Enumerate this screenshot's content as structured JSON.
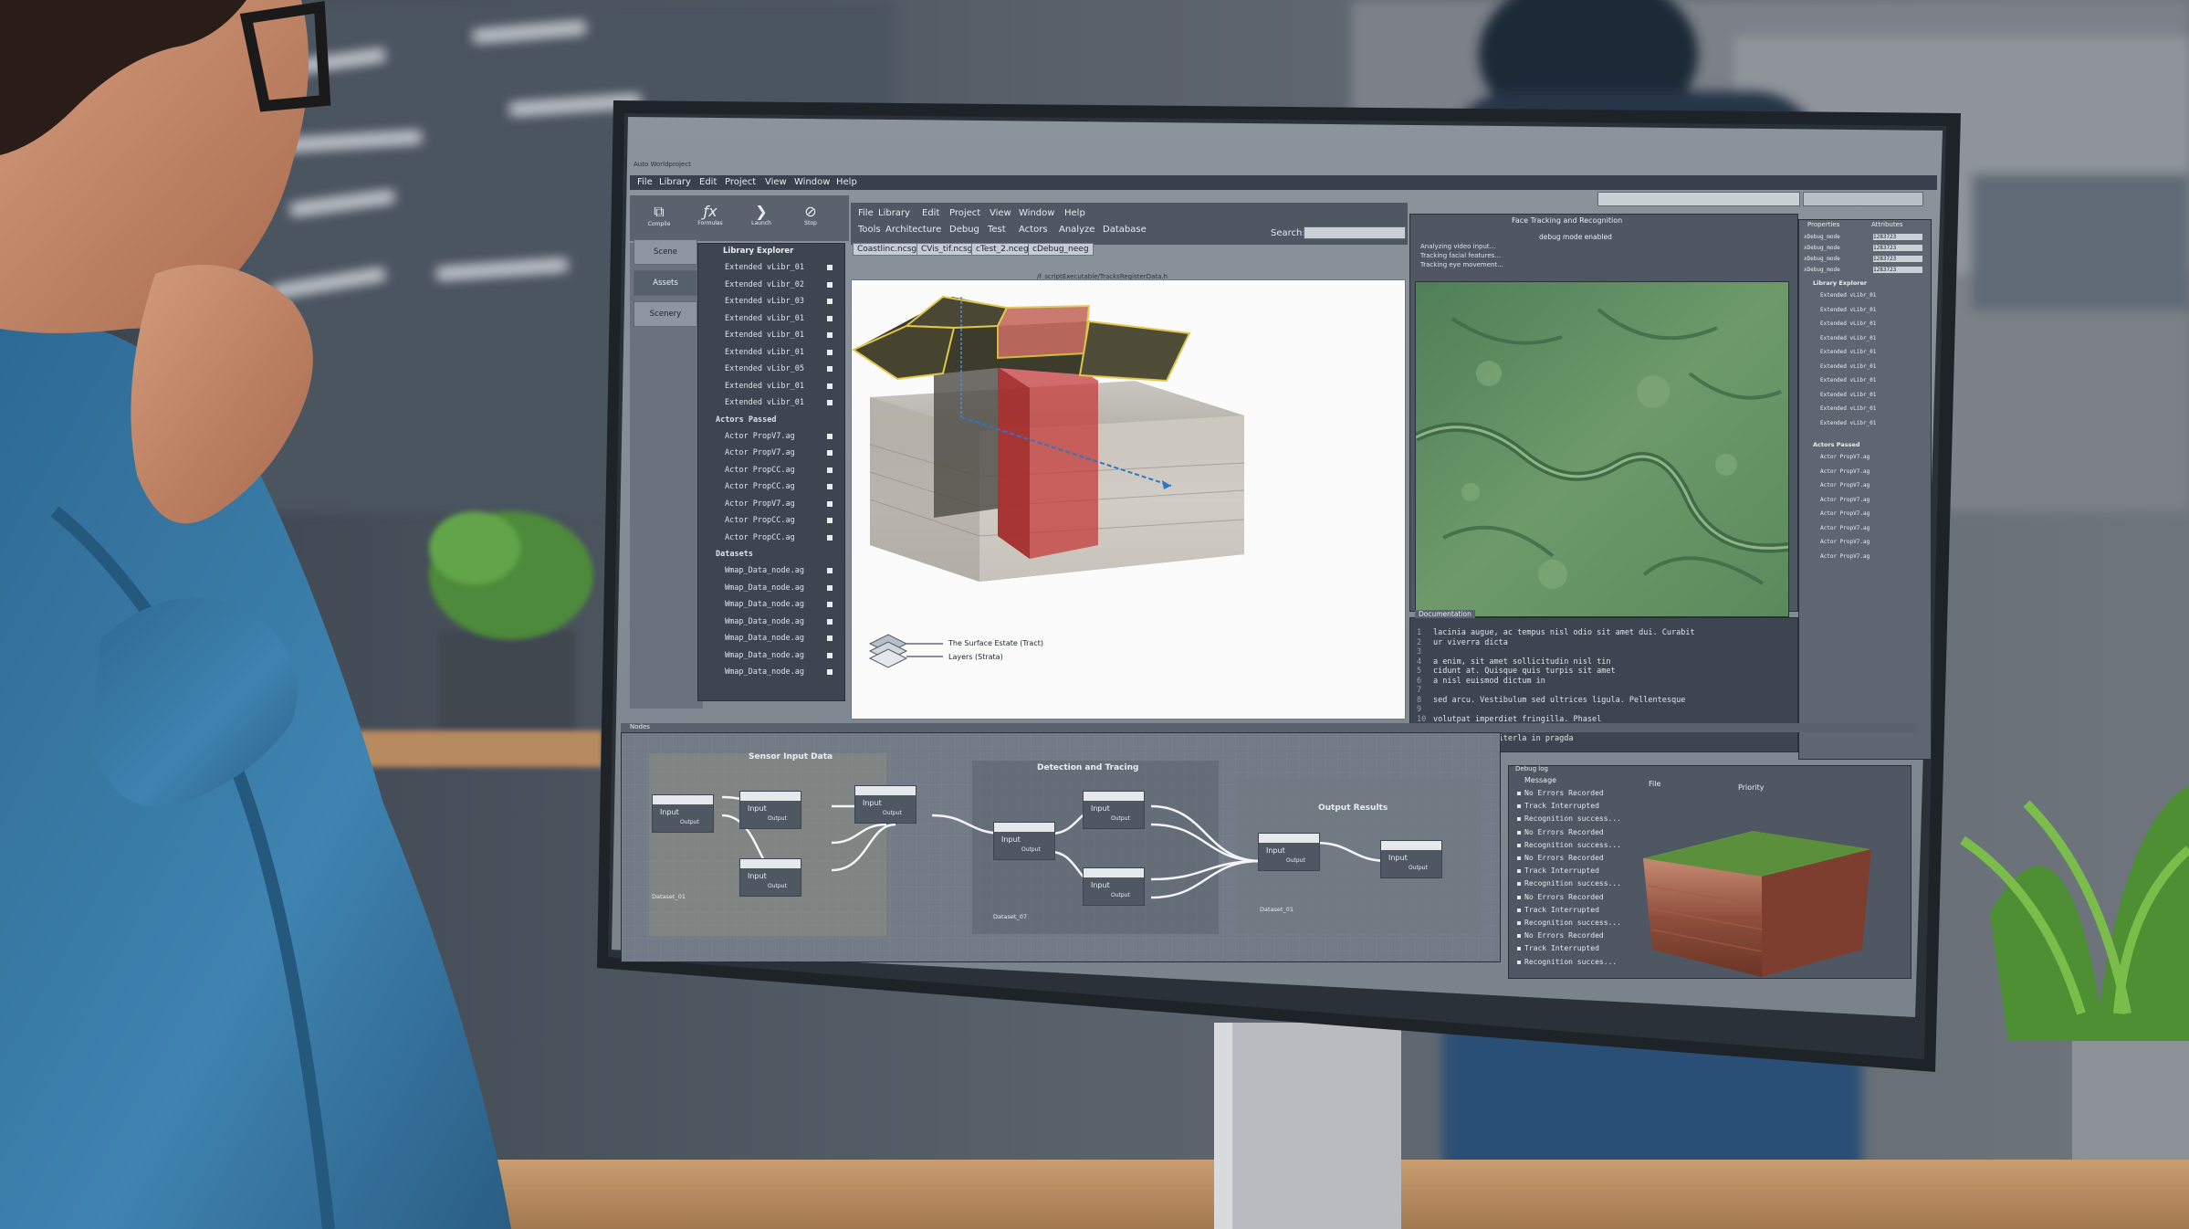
{
  "app": {
    "title": "Auto Worldproject"
  },
  "menu": {
    "top": [
      "File",
      "Library",
      "Edit",
      "Project",
      "View",
      "Window",
      "Help"
    ],
    "secondary_row1": [
      "File",
      "Library",
      "Edit",
      "Project",
      "View",
      "Window",
      "Help"
    ],
    "secondary_row2": [
      "Tools",
      "Architecture",
      "Debug",
      "Test",
      "Actors",
      "Analyze",
      "Database"
    ]
  },
  "toolbar": {
    "buttons": [
      "Compile",
      "Formulas",
      "Launch",
      "Stop"
    ]
  },
  "sidebar": {
    "buttons": [
      "Scene",
      "Assets",
      "Scenery"
    ]
  },
  "search": {
    "label": "Search:",
    "value": ""
  },
  "tabs": [
    "Coastlinc.ncsg",
    "CVis_tif.ncsg",
    "cTest_2.nceg",
    "cDebug_neeg"
  ],
  "viewport_path": "/f_scriptExecutable/TracksRegisterData.h",
  "library_explorer": {
    "title": "Library Explorer",
    "groups": [
      {
        "name": "",
        "items": [
          "Extended vLibr_01",
          "Extended vLibr_02",
          "Extended vLibr_03",
          "Extended vLibr_01",
          "Extended vLibr_01",
          "Extended vLibr_01",
          "Extended vLibr_05",
          "Extended vLibr_01",
          "Extended vLibr_01"
        ]
      },
      {
        "name": "Actors Passed",
        "items": [
          "Actor PropV7.ag",
          "Actor PropV7.ag",
          "Actor PropCC.ag",
          "Actor PropCC.ag",
          "Actor PropV7.ag",
          "Actor PropCC.ag",
          "Actor PropCC.ag"
        ]
      },
      {
        "name": "Datasets",
        "items": [
          "Wmap_Data_node.ag",
          "Wmap_Data_node.ag",
          "Wmap_Data_node.ag",
          "Wmap_Data_node.ag",
          "Wmap_Data_node.ag",
          "Wmap_Data_node.ag",
          "Wmap_Data_node.ag"
        ]
      }
    ]
  },
  "strata_legend": {
    "top": "The Surface Estate (Tract)",
    "bottom": "Layers (Strata)"
  },
  "face_tracking": {
    "title": "Face Tracking and Recognition",
    "status": "debug mode enabled",
    "lines": [
      "Analyzing video input...",
      "Tracking facial features...",
      "Tracking eye movement..."
    ]
  },
  "properties": {
    "tabs": [
      "Properties",
      "Attributes"
    ],
    "rows": [
      {
        "key": "xDebug_mode",
        "value": "1283723"
      },
      {
        "key": "xDebug_mode",
        "value": "1283723"
      },
      {
        "key": "xDebug_mode",
        "value": "1283723"
      },
      {
        "key": "xDebug_mode",
        "value": "1283723"
      }
    ],
    "groups": [
      {
        "name": "Library Explorer",
        "items": [
          "Extended vLibr_01",
          "Extended vLibr_01",
          "Extended vLibr_01",
          "Extended vLibr_01",
          "Extended vLibr_01",
          "Extended vLibr_01",
          "Extended vLibr_01",
          "Extended vLibr_01",
          "Extended vLibr_01",
          "Extended vLibr_01"
        ]
      },
      {
        "name": "Actors Passed",
        "items": [
          "Actor PropV7.ag",
          "Actor PropV7.ag",
          "Actor PropV7.ag",
          "Actor PropV7.ag",
          "Actor PropV7.ag",
          "Actor PropV7.ag",
          "Actor PropV7.ag",
          "Actor PropV7.ag"
        ]
      }
    ]
  },
  "documentation": {
    "title": "Documentation",
    "lines": [
      "lacinia augue, ac tempus nisl odio sit amet dui. Curabit",
      "   ur viverra dicta",
      "",
      "         a enim, sit amet sollicitudin nisl tin",
      "         cidunt at. Quisque quis turpis sit amet",
      "         a nisl euismod dictum in",
      "",
      "sed arcu. Vestibulum sed ultrices ligula. Pellentesque",
      "",
      "volutpat imperdiet fringilla. Phasel",
      "",
      "Use turpis in iterla in pragda"
    ]
  },
  "node_graph": {
    "panel_title": "Nodes",
    "groups": [
      {
        "title": "Sensor Input Data",
        "footer": "Dataset_01"
      },
      {
        "title": "Detection and Tracing",
        "footer": "Dataset_07"
      },
      {
        "title": "Output Results",
        "footer": "Dataset_01"
      }
    ],
    "node_in": "Input",
    "node_out": "Output"
  },
  "debug_log": {
    "panel_title": "Debug log",
    "columns": [
      "Message",
      "File",
      "Priority"
    ],
    "messages": [
      "No Errors Recorded",
      "Track Interrupted",
      "Recognition success...",
      "No Errors Recorded",
      "Recognition success...",
      "No Errors Recorded",
      "Track Interrupted",
      "Recognition success...",
      "No Errors Recorded",
      "Track Interrupted",
      "Recognition success...",
      "No Errors Recorded",
      "Track Interrupted",
      "Recognition succes..."
    ]
  }
}
